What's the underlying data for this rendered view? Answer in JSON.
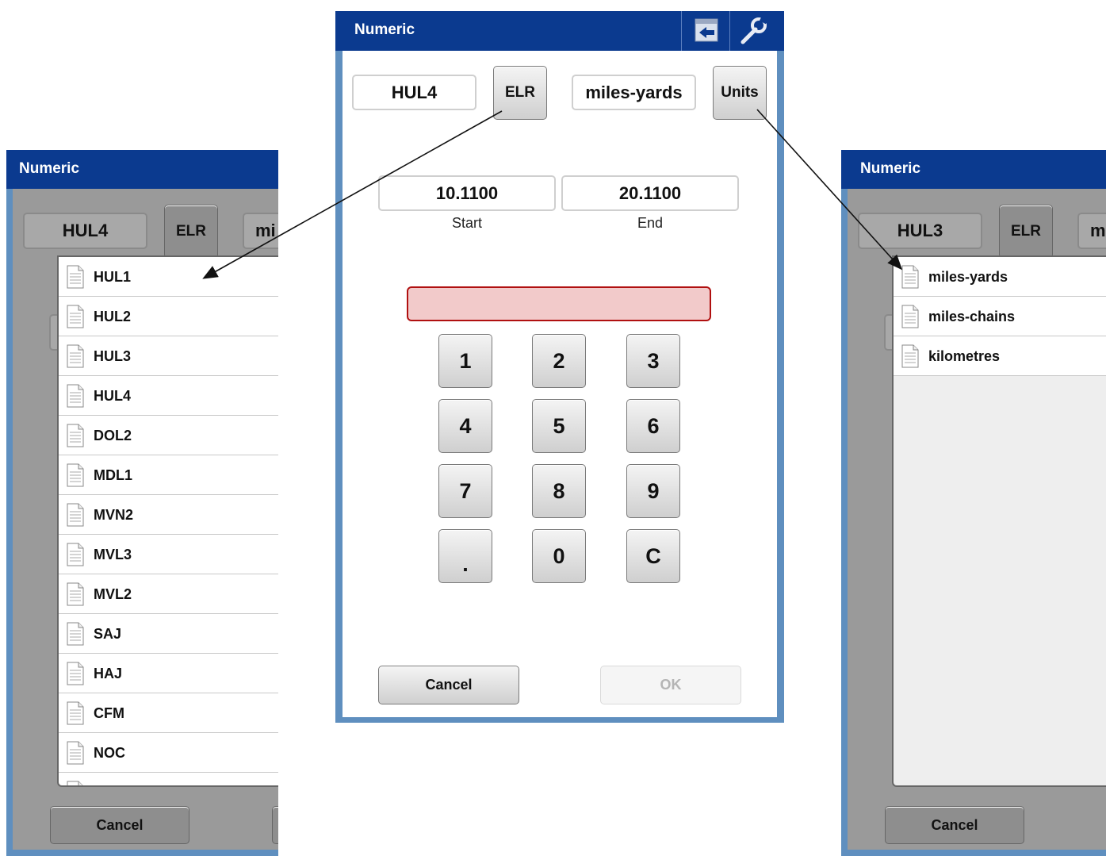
{
  "left_panel": {
    "title": "Numeric",
    "elr_value": "HUL4",
    "elr_button": "ELR",
    "units_partial": "mi",
    "list_items": [
      "HUL1",
      "HUL2",
      "HUL3",
      "HUL4",
      "DOL2",
      "MDL1",
      "MVN2",
      "MVL3",
      "MVL2",
      "SAJ",
      "HAJ",
      "CFM",
      "NOC"
    ],
    "cancel": "Cancel"
  },
  "center_panel": {
    "title": "Numeric",
    "back_icon": "back-arrow-icon",
    "settings_icon": "wrench-icon",
    "elr_value": "HUL4",
    "elr_button": "ELR",
    "units_value": "miles-yards",
    "units_button": "Units",
    "start_value": "10.1100",
    "start_label": "Start",
    "end_value": "20.1100",
    "end_label": "End",
    "entry_value": "",
    "keys": [
      "1",
      "2",
      "3",
      "4",
      "5",
      "6",
      "7",
      "8",
      "9",
      ".",
      "0",
      "C"
    ],
    "cancel": "Cancel",
    "ok": "OK"
  },
  "right_panel": {
    "title": "Numeric",
    "elr_value": "HUL3",
    "elr_button": "ELR",
    "units_partial": "m",
    "list_items": [
      "miles-yards",
      "miles-chains",
      "kilometres"
    ],
    "cancel": "Cancel"
  },
  "colors": {
    "titlebar": "#0b3a8f",
    "frame": "#5f8fbf",
    "entry_fill": "#f2caca",
    "entry_border": "#b01010",
    "dim_overlay": "#9a9a9a"
  }
}
